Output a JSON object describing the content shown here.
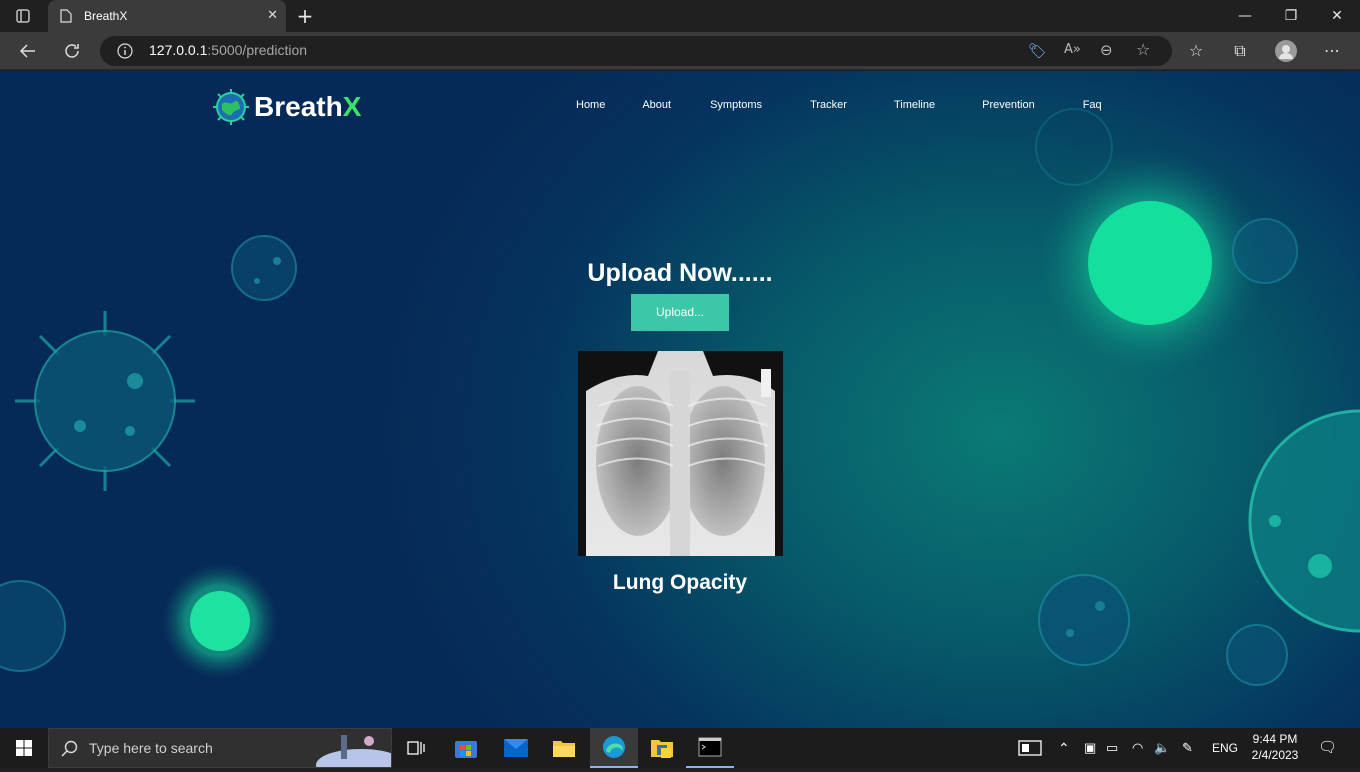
{
  "browser": {
    "tab_title": "BreathX",
    "url_host": "127.0.0.1",
    "url_rest": ":5000/prediction"
  },
  "site": {
    "logo_text": "Breath",
    "logo_accent": "X",
    "nav": [
      "Home",
      "About",
      "Symptoms",
      "Tracker",
      "Timeline",
      "Prevention",
      "Faq"
    ],
    "headline": "Upload Now......",
    "upload_label": "Upload...",
    "result": "Lung Opacity"
  },
  "taskbar": {
    "search_placeholder": "Type here to search",
    "language": "ENG",
    "time": "9:44 PM",
    "date": "2/4/2023"
  },
  "colors": {
    "accent_green": "#3be26a",
    "button_teal": "#3bc7a8",
    "page_bg": "#05345e"
  }
}
